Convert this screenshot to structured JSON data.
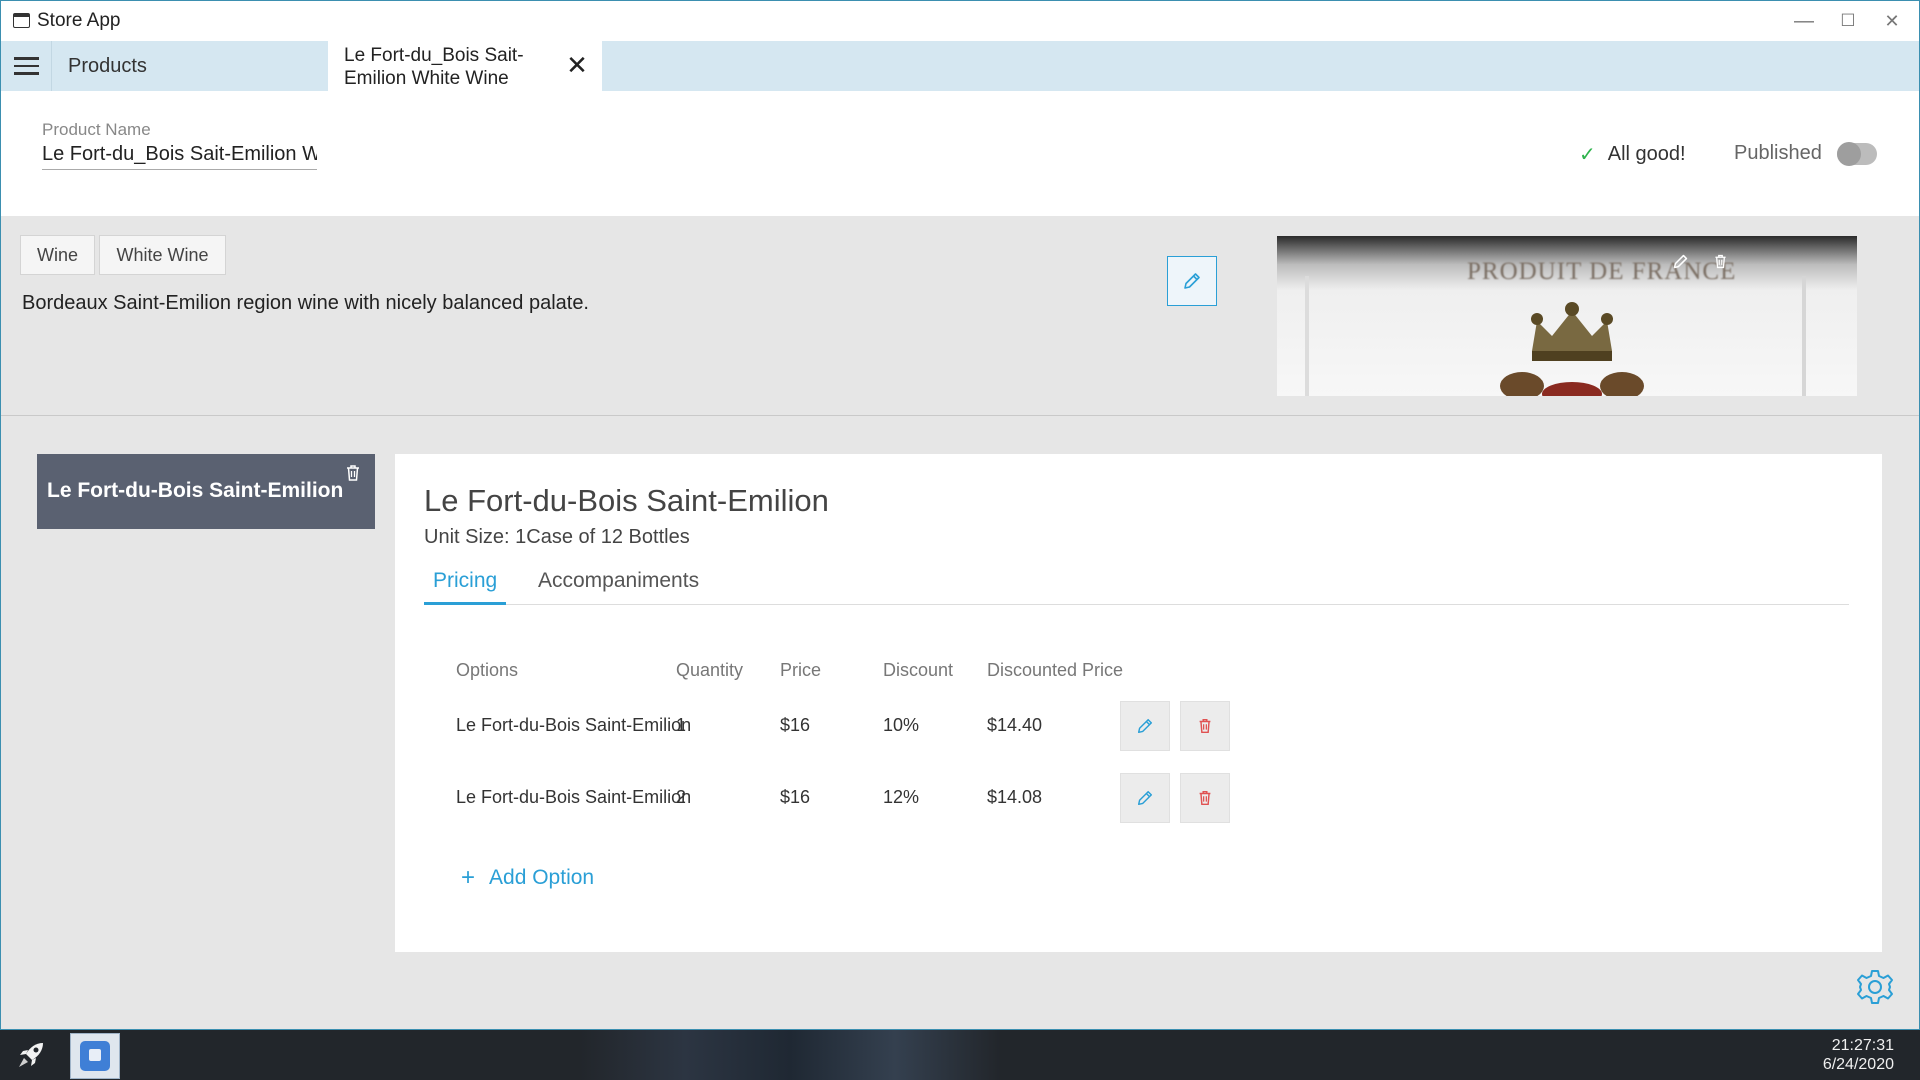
{
  "window": {
    "title": "Store App",
    "controls": {
      "minimize": "—",
      "maximize": "☐",
      "close": "✕"
    }
  },
  "tabs": {
    "products_label": "Products",
    "active_label": "Le Fort-du_Bois Sait-Emilion White Wine",
    "close_glyph": "✕"
  },
  "header": {
    "product_name_label": "Product Name",
    "product_name_value": "Le Fort-du_Bois Sait-Emilion White Wine",
    "status_check": "✓",
    "status_text": "All good!",
    "published_label": "Published",
    "published": false
  },
  "description": {
    "tags": [
      "Wine",
      "White Wine"
    ],
    "text": "Bordeaux Saint-Emilion region wine with nicely balanced palate.",
    "image_text": "PRODUIT DE FRANCE"
  },
  "variant": {
    "name": "Le Fort-du-Bois Saint-Emilion"
  },
  "detail": {
    "title": "Le Fort-du-Bois Saint-Emilion",
    "unit_size": "Unit Size: 1Case of 12 Bottles",
    "tabs": [
      "Pricing",
      "Accompaniments"
    ],
    "active_tab": "Pricing",
    "columns": [
      "Options",
      "Quantity",
      "Price",
      "Discount",
      "Discounted Price"
    ],
    "rows": [
      {
        "option": "Le Fort-du-Bois Saint-Emilion",
        "quantity": "1",
        "price": "$16",
        "discount": "10%",
        "discounted_price": "$14.40"
      },
      {
        "option": "Le Fort-du-Bois Saint-Emilion",
        "quantity": "2",
        "price": "$16",
        "discount": "12%",
        "discounted_price": "$14.08"
      }
    ],
    "add_option_label": "Add Option",
    "add_option_icon": "+"
  },
  "taskbar": {
    "time": "21:27:31",
    "date": "6/24/2020"
  },
  "icons": {
    "edit": "pencil-icon",
    "delete": "trash-icon",
    "settings": "gear-icon",
    "launcher": "rocket-icon"
  },
  "colors": {
    "accent": "#2a9fd6",
    "danger": "#e05252",
    "success": "#2eb34d",
    "variant_card": "#5a6171",
    "tab_strip": "#d5e7f1"
  }
}
